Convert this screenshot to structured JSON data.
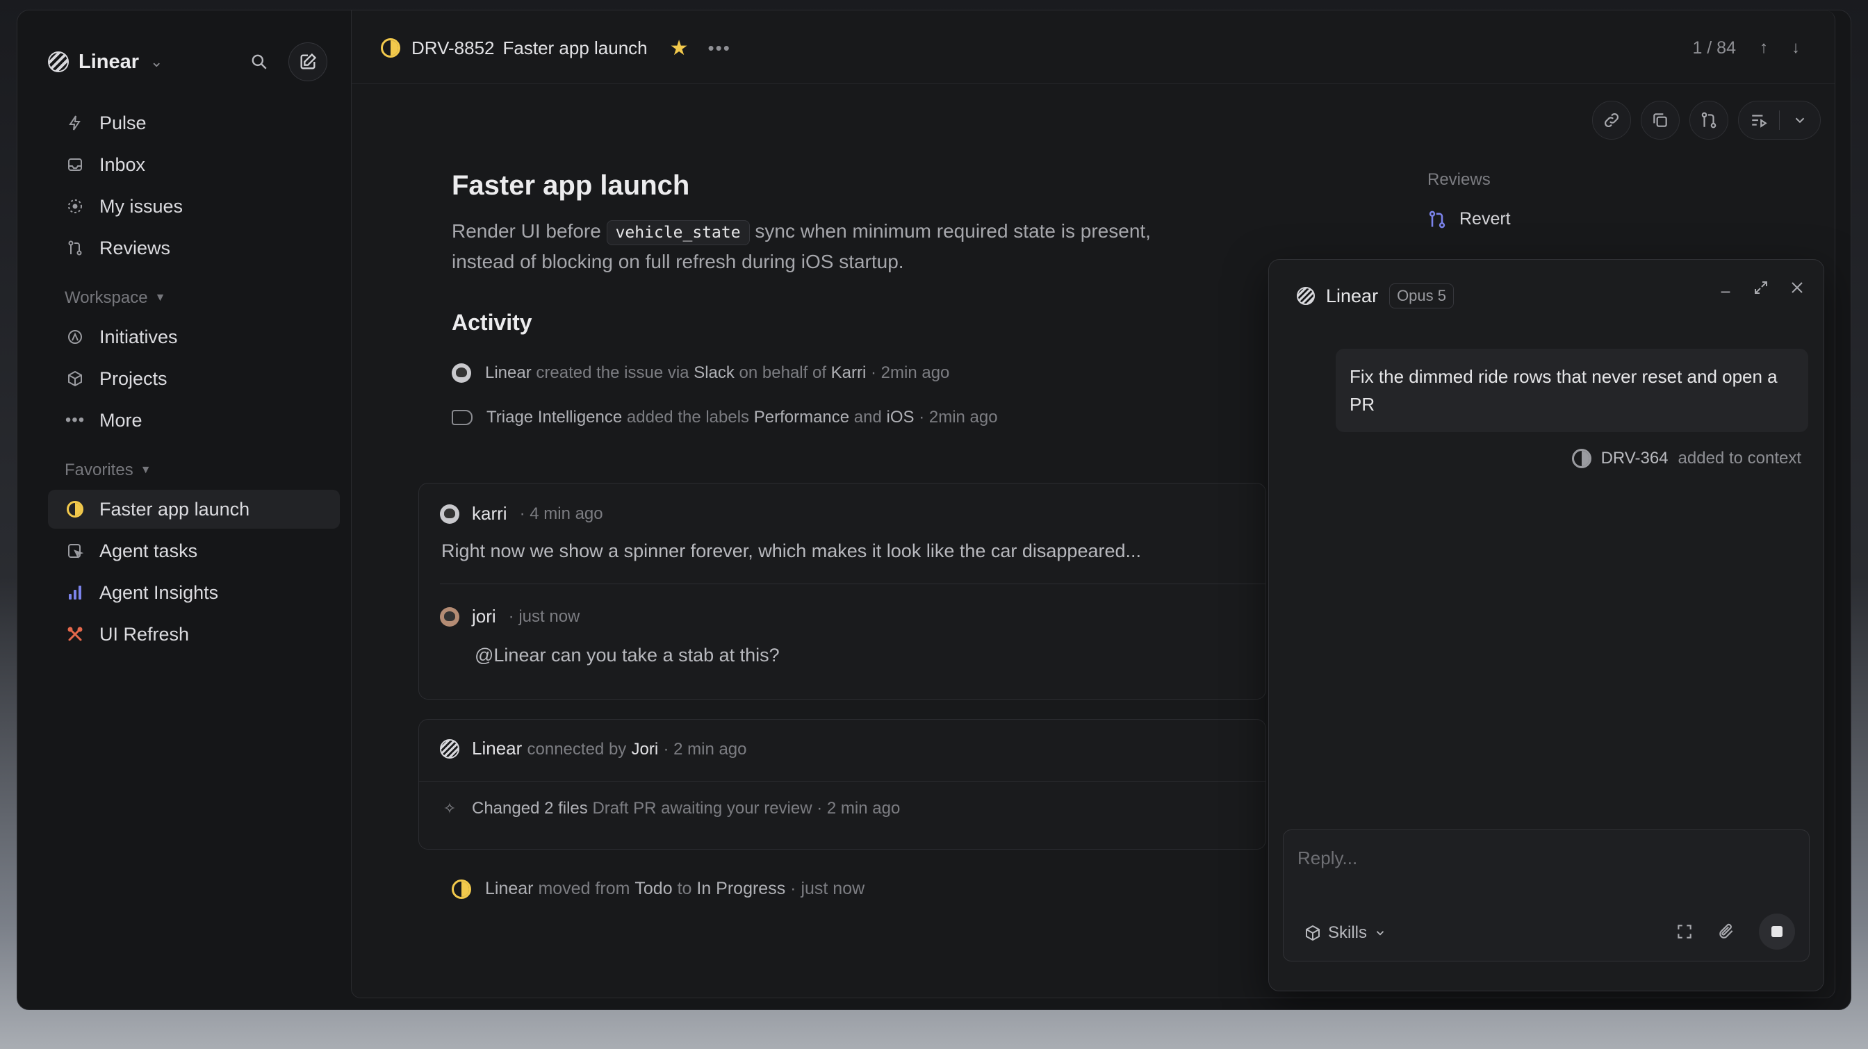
{
  "workspace": {
    "name": "Linear"
  },
  "sidebar": {
    "nav": [
      {
        "label": "Pulse",
        "icon": "pulse-icon"
      },
      {
        "label": "Inbox",
        "icon": "inbox-icon"
      },
      {
        "label": "My issues",
        "icon": "my-issues-icon"
      },
      {
        "label": "Reviews",
        "icon": "reviews-icon"
      }
    ],
    "workspace_label": "Workspace",
    "workspace_items": [
      {
        "label": "Initiatives",
        "icon": "initiatives-icon"
      },
      {
        "label": "Projects",
        "icon": "projects-icon"
      },
      {
        "label": "More",
        "icon": "more-icon"
      }
    ],
    "favorites_label": "Favorites",
    "favorites": [
      {
        "label": "Faster app launch",
        "icon": "in-progress-icon"
      },
      {
        "label": "Agent tasks",
        "icon": "agent-tasks-icon"
      },
      {
        "label": "Agent Insights",
        "icon": "bar-chart-icon"
      },
      {
        "label": "UI Refresh",
        "icon": "ui-refresh-icon"
      }
    ]
  },
  "header": {
    "issue_id": "DRV-8852",
    "issue_title": "Faster app launch",
    "pager": "1 / 84"
  },
  "issue": {
    "title": "Faster app launch",
    "desc_before": "Render UI before ",
    "desc_code": "vehicle_state",
    "desc_after": " sync when minimum required state is present, instead of blocking on full refresh during iOS startup.",
    "activity_heading": "Activity"
  },
  "activity": {
    "row1": {
      "actor": "Linear",
      "t1": "created the issue via",
      "via": "Slack",
      "t2": "on behalf of",
      "who": "Karri",
      "time": "· 2min ago"
    },
    "row2": {
      "actor": "Triage Intelligence",
      "t1": "added the labels",
      "l1": "Performance",
      "t2": "and",
      "l2": "iOS",
      "time": "· 2min ago"
    },
    "comment1": {
      "author": "karri",
      "time": "· 4 min ago",
      "body": "Right now we show a spinner forever, which makes it look like the car disappeared..."
    },
    "comment2": {
      "author": "jori",
      "time": "· just now",
      "body": "@Linear can you take a stab at this?"
    },
    "agent": {
      "name": "Linear",
      "t1": "connected by",
      "who": "Jori",
      "time": "· 2 min ago",
      "changed": "Changed 2 files",
      "status": "Draft PR awaiting your review",
      "status_time": "· 2 min ago"
    },
    "moved": {
      "actor": "Linear",
      "t1": "moved from",
      "from": "Todo",
      "t2": "to",
      "to": "In Progress",
      "time": "· just now"
    }
  },
  "side": {
    "reviews_label": "Reviews",
    "revert_label": "Revert"
  },
  "chat": {
    "title": "Linear",
    "model": "Opus 5",
    "message": "Fix the dimmed ride rows that never reset and open a PR",
    "context_id": "DRV-364",
    "context_text": "added to context",
    "placeholder": "Reply...",
    "skills_label": "Skills"
  },
  "colors": {
    "accent_yellow": "#f2c94c",
    "accent_purple": "#7b83eb",
    "accent_red": "#e5684b",
    "bg": "#151618"
  }
}
